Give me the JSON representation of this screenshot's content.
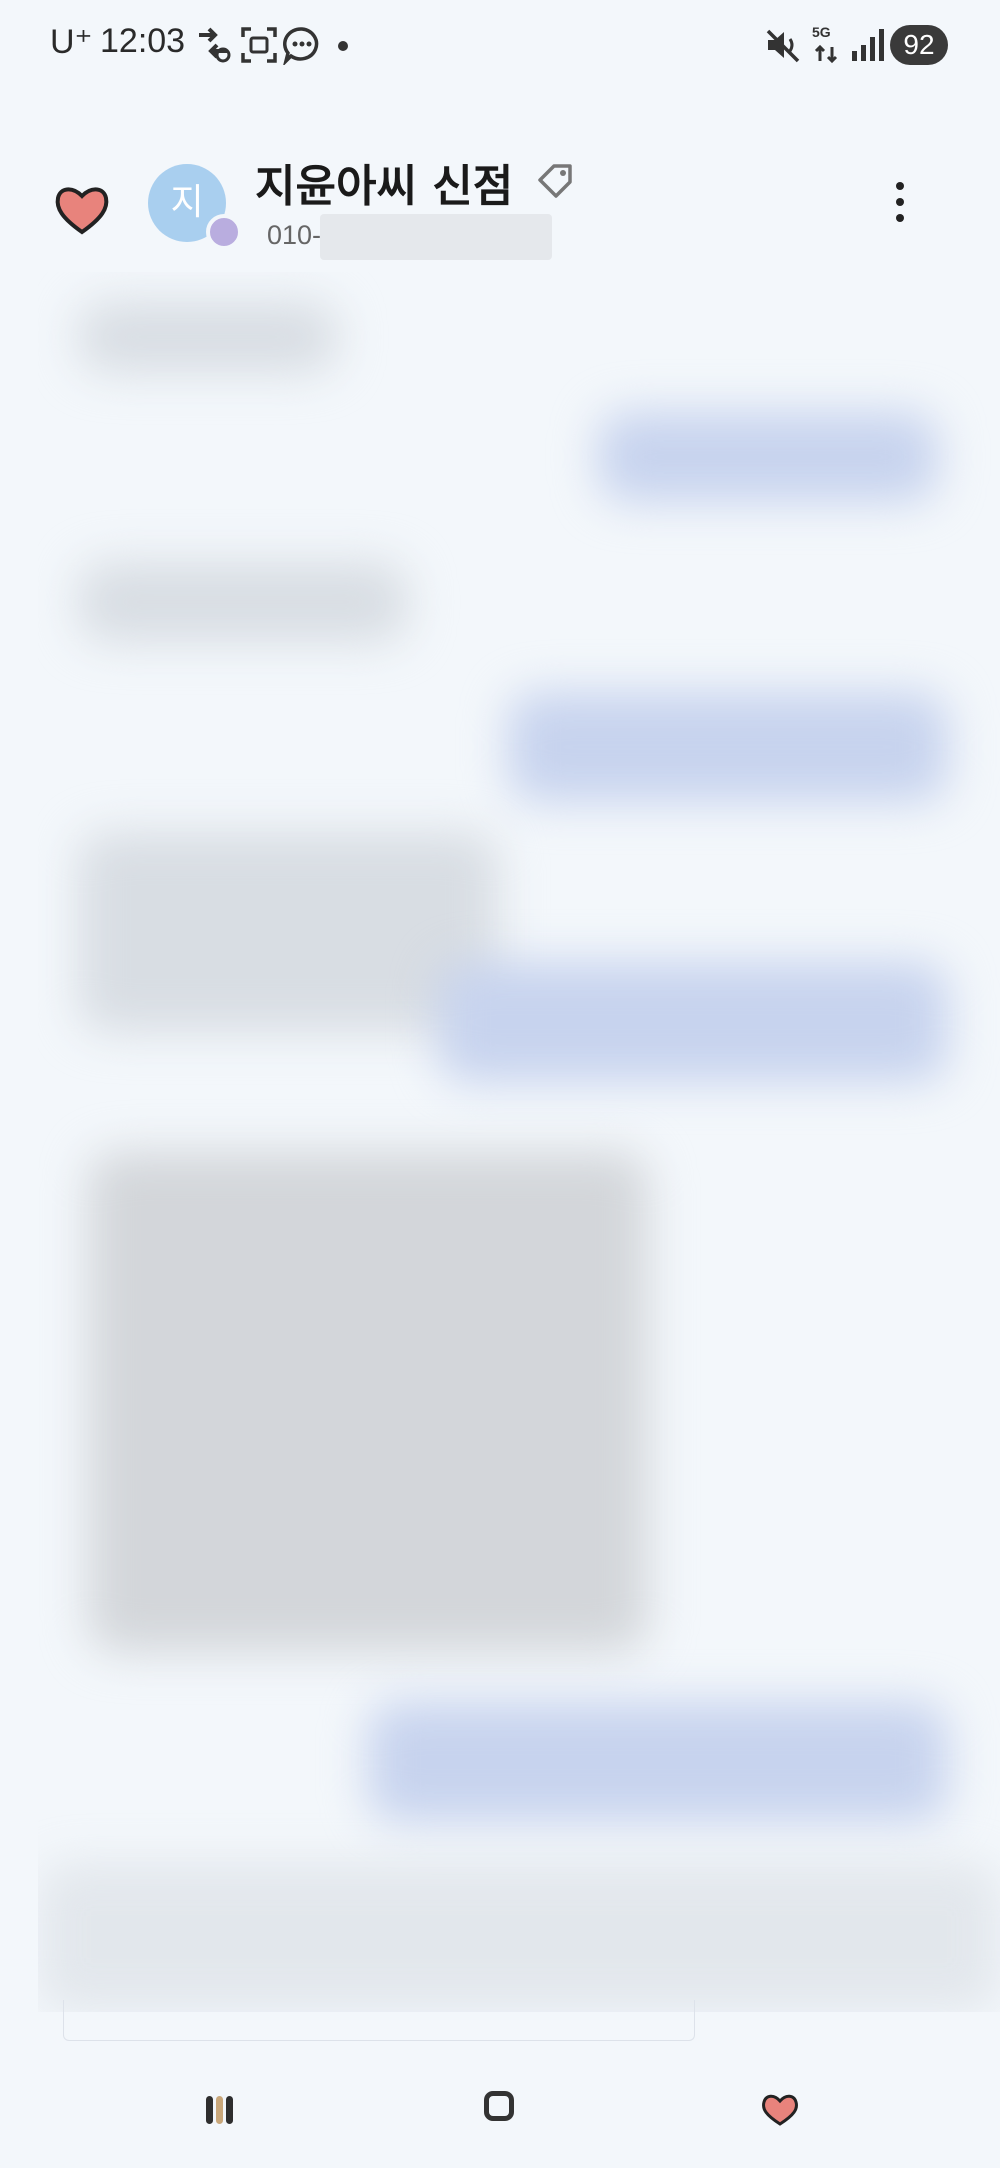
{
  "status_bar": {
    "carrier": "U⁺",
    "time": "12:03",
    "network": "5G",
    "battery": "92"
  },
  "header": {
    "contact_name": "지윤아씨 신점",
    "avatar_initial": "지",
    "phone_prefix": "010-"
  },
  "colors": {
    "background": "#f3f7fb",
    "received_bubble": "#d8dde3",
    "sent_bubble": "#c7d3ee",
    "avatar": "#a9cfef",
    "avatar_badge": "#b9addf",
    "heart": "#e8837c"
  },
  "icons": {
    "status": [
      "data-transfer-icon",
      "screenshot-icon",
      "message-icon",
      "mute-icon",
      "signal-icon"
    ],
    "header": [
      "heart-icon",
      "tag-icon",
      "more-options-icon"
    ],
    "nav": [
      "recent-apps-icon",
      "home-icon",
      "back-icon"
    ]
  }
}
